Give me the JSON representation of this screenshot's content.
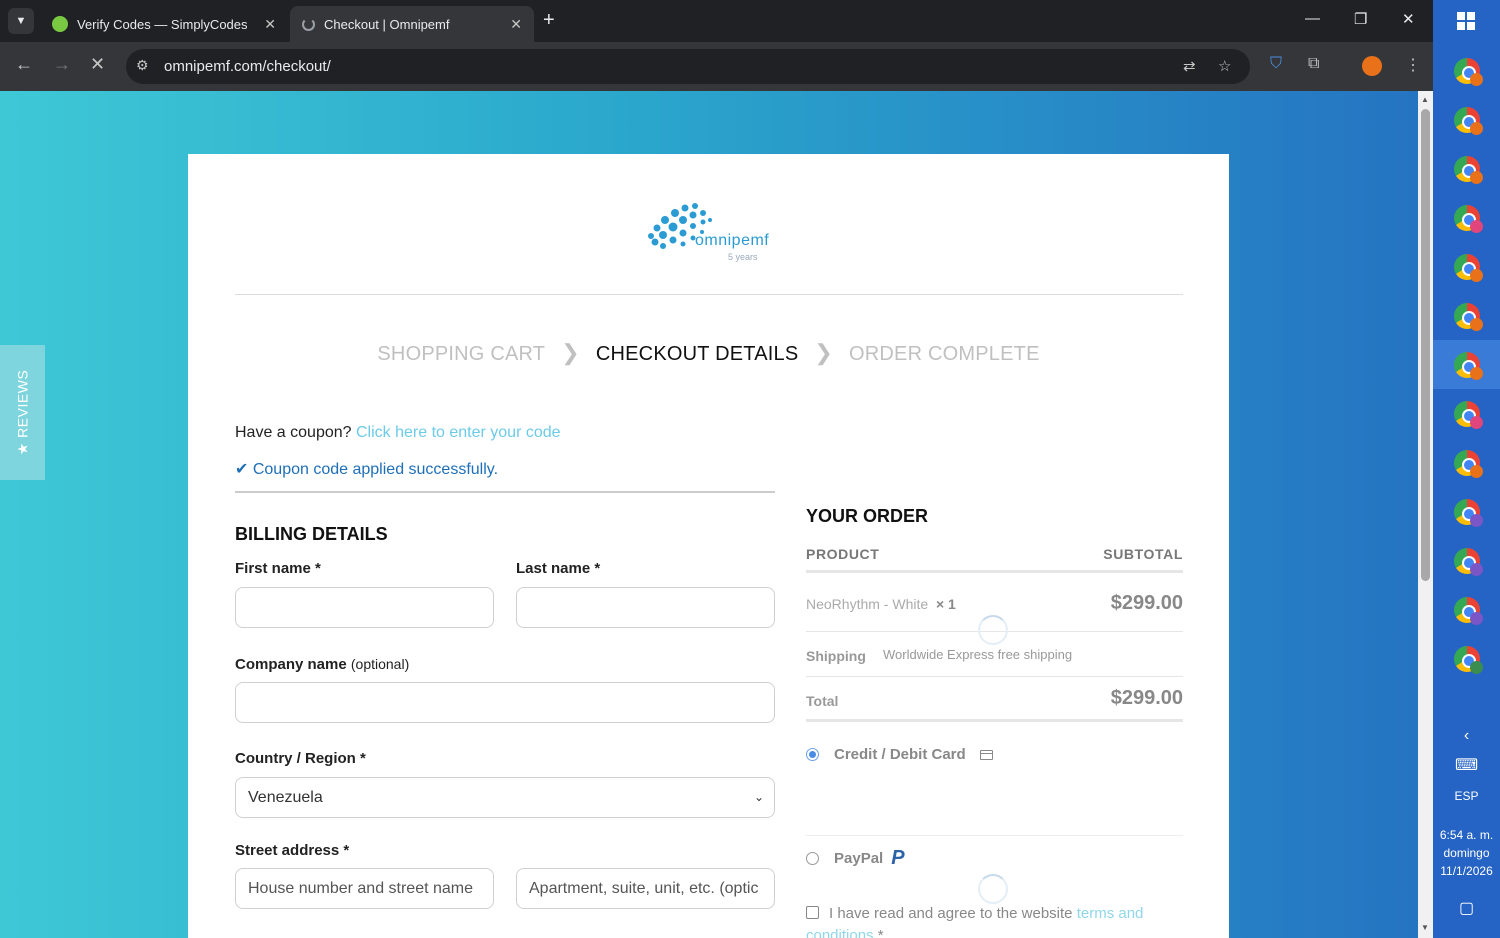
{
  "browser": {
    "tabs": [
      {
        "title": "Verify Codes — SimplyCodes",
        "active": false,
        "favicon_color": "#7ac943"
      },
      {
        "title": "Checkout | Omnipemf",
        "active": true,
        "favicon_color": "#9aa0a6"
      }
    ],
    "url": "omnipemf.com/checkout/"
  },
  "sidebar_tab": {
    "label": "★ REVIEWS"
  },
  "logo": {
    "brand": "omnipemf",
    "tagline": "5 years"
  },
  "steps": {
    "cart": "SHOPPING CART",
    "details": "CHECKOUT DETAILS",
    "complete": "ORDER COMPLETE"
  },
  "coupon": {
    "prompt": "Have a coupon?",
    "link": "Click here to enter your code",
    "success": "✔ Coupon code applied successfully."
  },
  "billing": {
    "heading": "BILLING DETAILS",
    "first_name_label": "First name *",
    "last_name_label": "Last name *",
    "company_label": "Company name",
    "company_optional": "(optional)",
    "country_label": "Country / Region *",
    "country_value": "Venezuela",
    "street_label": "Street address *",
    "street_placeholder": "House number and street name",
    "apt_placeholder": "Apartment, suite, unit, etc. (optic"
  },
  "order": {
    "heading": "YOUR ORDER",
    "col_product": "PRODUCT",
    "col_subtotal": "SUBTOTAL",
    "item_name": "NeoRhythm - White",
    "item_qty": "× 1",
    "item_price": "$299.00",
    "shipping_label": "Shipping",
    "shipping_value": "Worldwide Express free shipping",
    "total_label": "Total",
    "total_value": "$299.00"
  },
  "payment": {
    "card_label": "Credit / Debit Card",
    "paypal_label": "PayPal",
    "selected": "card",
    "terms_text": "I have read and agree to the website",
    "terms_link": "terms and conditions",
    "terms_req": "*"
  },
  "taskbar": {
    "language": "ESP",
    "time": "6:54 a. m.",
    "day": "domingo",
    "date": "11/1/2026",
    "badges": [
      "#e8711a",
      "#e8711a",
      "#e8711a",
      "#e0457b",
      "#e8711a",
      "#e8711a",
      "#e8711a",
      "#e0457b",
      "#e8711a",
      "#7a56c6",
      "#7a56c6",
      "#7a56c6",
      "#3b8d4f"
    ]
  }
}
